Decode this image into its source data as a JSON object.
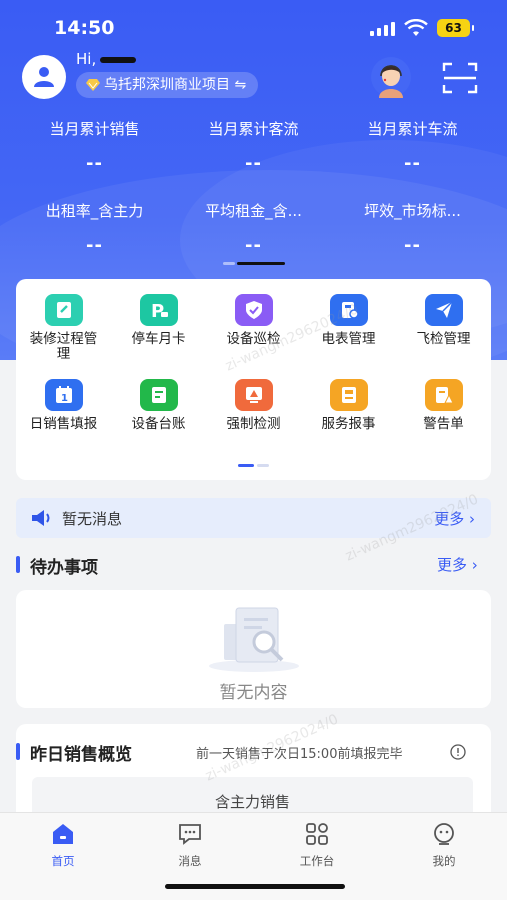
{
  "status_bar": {
    "time": "14:50",
    "battery": "63"
  },
  "user": {
    "greeting": "Hi,",
    "project": "乌托邦深圳商业项目 ⇋"
  },
  "stats": [
    {
      "label": "当月累计销售",
      "value": "--"
    },
    {
      "label": "当月累计客流",
      "value": "--"
    },
    {
      "label": "当月累计车流",
      "value": "--"
    },
    {
      "label": "出租率_含主力",
      "value": "--"
    },
    {
      "label": "平均租金_含...",
      "value": "--"
    },
    {
      "label": "坪效_市场标...",
      "value": "--"
    }
  ],
  "menu": [
    {
      "label": "装修过程管理",
      "icon": "renovation-icon",
      "color": "#2ccfb1"
    },
    {
      "label": "停车月卡",
      "icon": "parking-icon",
      "color": "#1dc7a2"
    },
    {
      "label": "设备巡检",
      "icon": "inspection-icon",
      "color": "#8a5cf5"
    },
    {
      "label": "电表管理",
      "icon": "meter-icon",
      "color": "#2f6ff0"
    },
    {
      "label": "飞检管理",
      "icon": "paper-plane-icon",
      "color": "#2f6ff0"
    },
    {
      "label": "日销售填报",
      "icon": "calendar-icon",
      "color": "#2f6ff0"
    },
    {
      "label": "设备台账",
      "icon": "ledger-icon",
      "color": "#22b84a"
    },
    {
      "label": "强制检测",
      "icon": "forced-check-icon",
      "color": "#f06a3c"
    },
    {
      "label": "服务报事",
      "icon": "service-icon",
      "color": "#f5a524"
    },
    {
      "label": "警告单",
      "icon": "warning-doc-icon",
      "color": "#f5a524"
    }
  ],
  "notice": {
    "text": "暂无消息",
    "more": "更多"
  },
  "todo": {
    "title": "待办事项",
    "more": "更多",
    "empty": "暂无内容"
  },
  "sales": {
    "title": "昨日销售概览",
    "hint": "前一天销售于次日15:00前填报完毕",
    "item": "含主力销售"
  },
  "tabs": [
    {
      "label": "首页",
      "icon": "home-icon"
    },
    {
      "label": "消息",
      "icon": "message-icon"
    },
    {
      "label": "工作台",
      "icon": "workbench-icon"
    },
    {
      "label": "我的",
      "icon": "profile-icon"
    }
  ],
  "colors": {
    "primary": "#3a5cf4",
    "header": "#4467f5"
  }
}
